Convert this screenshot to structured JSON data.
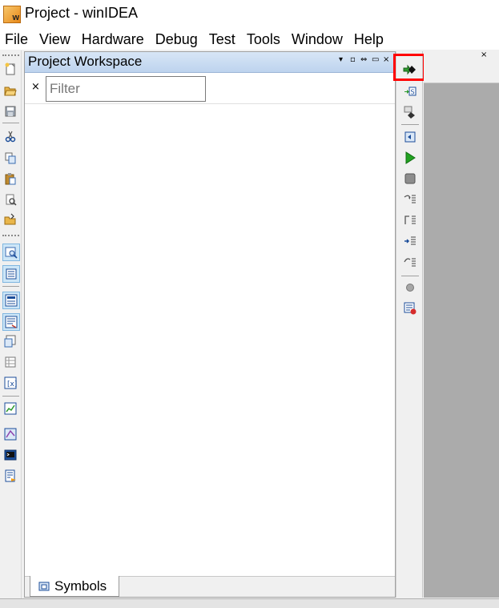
{
  "window": {
    "title": "Project - winIDEA",
    "app_icon_letter": "w"
  },
  "menu": [
    "File",
    "View",
    "Hardware",
    "Debug",
    "Test",
    "Tools",
    "Window",
    "Help"
  ],
  "workspace": {
    "title": "Project Workspace",
    "filter_clear": "×",
    "filter_placeholder": "Filter",
    "filter_value": "",
    "bottom_tab": "Symbols",
    "header_controls": [
      "▾",
      "▫",
      "⇔",
      "▭",
      "×"
    ]
  },
  "document_close": "×",
  "colors": {
    "highlight": "#ff0000",
    "panel_header": "#c9dcf2",
    "doc_background": "#ababab"
  },
  "left_toolbar_icons": [
    "new-file-icon",
    "open-folder-icon",
    "save-icon",
    "cut-icon",
    "copy-icon",
    "paste-icon",
    "print-preview-icon",
    "open-project-icon",
    "find-icon",
    "document-icon",
    "memory-window-icon",
    "watch-window-icon",
    "disassembly-icon",
    "registers-icon",
    "variables-icon",
    "trace-icon",
    "profiler-icon",
    "terminal-icon",
    "script-icon"
  ],
  "right_toolbar_icons": [
    "download-icon",
    "download-symbols-icon",
    "reset-icon",
    "run-until-icon",
    "run-icon",
    "stop-icon",
    "step-into-icon",
    "step-over-icon",
    "run-to-cursor-icon",
    "step-out-icon",
    "breakpoint-icon",
    "breakpoints-window-icon"
  ]
}
